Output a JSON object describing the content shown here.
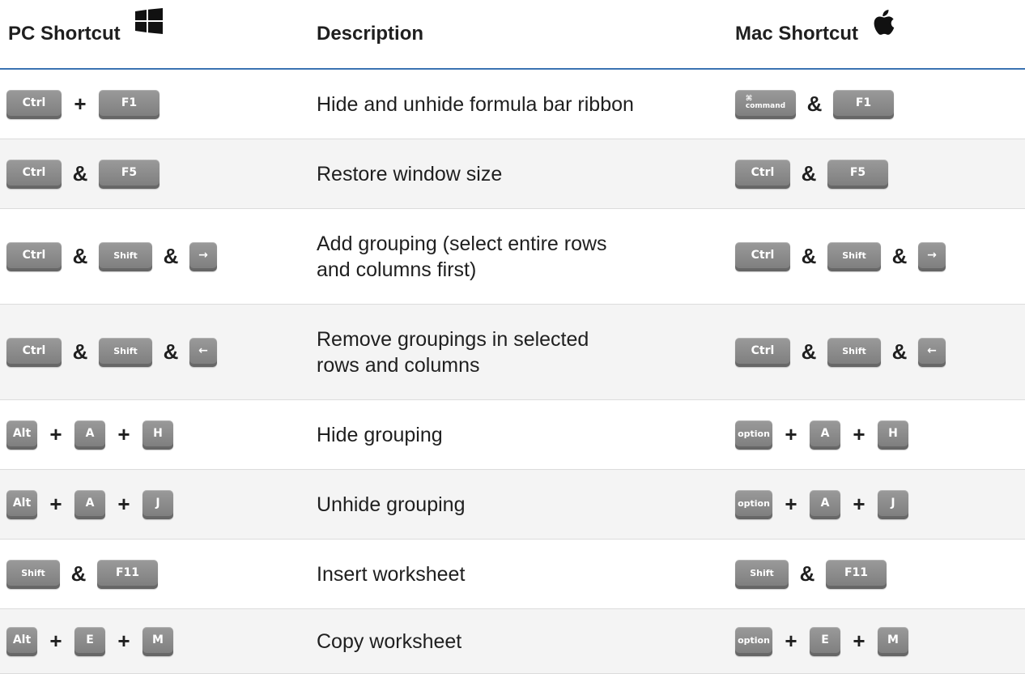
{
  "header": {
    "pc": "PC Shortcut",
    "description": "Description",
    "mac": "Mac Shortcut",
    "pc_icon": "windows-logo-icon",
    "mac_icon": "apple-logo-icon"
  },
  "colors": {
    "divider": "#3b73b2",
    "key": "#8a8a8a",
    "row_alt": "#f4f4f4"
  },
  "rows": [
    {
      "pc": [
        {
          "k": "Ctrl"
        },
        {
          "op": "+"
        },
        {
          "k": "F1"
        }
      ],
      "description": "Hide and unhide formula bar ribbon",
      "mac": [
        {
          "k": "⌘",
          "k2": "command"
        },
        {
          "op": "&"
        },
        {
          "k": "F1"
        }
      ]
    },
    {
      "pc": [
        {
          "k": "Ctrl"
        },
        {
          "op": "&"
        },
        {
          "k": "F5"
        }
      ],
      "description": "Restore window size",
      "mac": [
        {
          "k": "Ctrl"
        },
        {
          "op": "&"
        },
        {
          "k": "F5"
        }
      ]
    },
    {
      "pc": [
        {
          "k": "Ctrl"
        },
        {
          "op": "&"
        },
        {
          "k": "Shift"
        },
        {
          "op": "&"
        },
        {
          "k": "→"
        }
      ],
      "description": "Add grouping (select entire rows\nand columns first)",
      "mac": [
        {
          "k": "Ctrl"
        },
        {
          "op": "&"
        },
        {
          "k": "Shift"
        },
        {
          "op": "&"
        },
        {
          "k": "→"
        }
      ]
    },
    {
      "pc": [
        {
          "k": "Ctrl"
        },
        {
          "op": "&"
        },
        {
          "k": "Shift"
        },
        {
          "op": "&"
        },
        {
          "k": "←"
        }
      ],
      "description": "Remove groupings in selected\nrows and columns",
      "mac": [
        {
          "k": "Ctrl"
        },
        {
          "op": "&"
        },
        {
          "k": "Shift"
        },
        {
          "op": "&"
        },
        {
          "k": "←"
        }
      ]
    },
    {
      "pc": [
        {
          "k": "Alt"
        },
        {
          "op": "+"
        },
        {
          "k": "A"
        },
        {
          "op": "+"
        },
        {
          "k": "H"
        }
      ],
      "description": "Hide grouping",
      "mac": [
        {
          "k": "option"
        },
        {
          "op": "+"
        },
        {
          "k": "A"
        },
        {
          "op": "+"
        },
        {
          "k": "H"
        }
      ]
    },
    {
      "pc": [
        {
          "k": "Alt"
        },
        {
          "op": "+"
        },
        {
          "k": "A"
        },
        {
          "op": "+"
        },
        {
          "k": "J"
        }
      ],
      "description": "Unhide grouping",
      "mac": [
        {
          "k": "option"
        },
        {
          "op": "+"
        },
        {
          "k": "A"
        },
        {
          "op": "+"
        },
        {
          "k": "J"
        }
      ]
    },
    {
      "pc": [
        {
          "k": "Shift"
        },
        {
          "op": "&"
        },
        {
          "k": "F11"
        }
      ],
      "description": "Insert worksheet",
      "mac": [
        {
          "k": "Shift"
        },
        {
          "op": "&"
        },
        {
          "k": "F11"
        }
      ]
    },
    {
      "pc": [
        {
          "k": "Alt"
        },
        {
          "op": "+"
        },
        {
          "k": "E"
        },
        {
          "op": "+"
        },
        {
          "k": "M"
        }
      ],
      "description": "Copy worksheet",
      "mac": [
        {
          "k": "option"
        },
        {
          "op": "+"
        },
        {
          "k": "E"
        },
        {
          "op": "+"
        },
        {
          "k": "M"
        }
      ]
    }
  ]
}
